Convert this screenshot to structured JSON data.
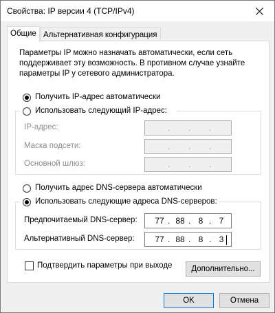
{
  "window": {
    "title": "Свойства: IP версии 4 (TCP/IPv4)"
  },
  "tabs": [
    {
      "label": "Общие"
    },
    {
      "label": "Альтернативная конфигурация"
    }
  ],
  "description": "Параметры IP можно назначать автоматически, если сеть поддерживает эту возможность. В противном случае узнайте параметры IP у сетевого администратора.",
  "ip_section": {
    "auto_label": "Получить IP-адрес автоматически",
    "manual_label": "Использовать следующий IP-адрес:",
    "auto_selected": true,
    "fields": [
      {
        "label": "IP-адрес:"
      },
      {
        "label": "Маска подсети:"
      },
      {
        "label": "Основной шлюз:"
      }
    ]
  },
  "dns_section": {
    "auto_label": "Получить адрес DNS-сервера автоматически",
    "manual_label": "Использовать следующие адреса DNS-серверов:",
    "manual_selected": true,
    "preferred": {
      "label": "Предпочитаемый DNS-сервер:",
      "octets": [
        "77",
        "88",
        "8",
        "7"
      ]
    },
    "alternate": {
      "label": "Альтернативный DNS-сервер:",
      "octets": [
        "77",
        "88",
        "8",
        "3"
      ]
    }
  },
  "validate": {
    "label": "Подтвердить параметры при выходе",
    "checked": false
  },
  "buttons": {
    "advanced": "Дополнительно...",
    "ok": "OK",
    "cancel": "Отмена"
  }
}
